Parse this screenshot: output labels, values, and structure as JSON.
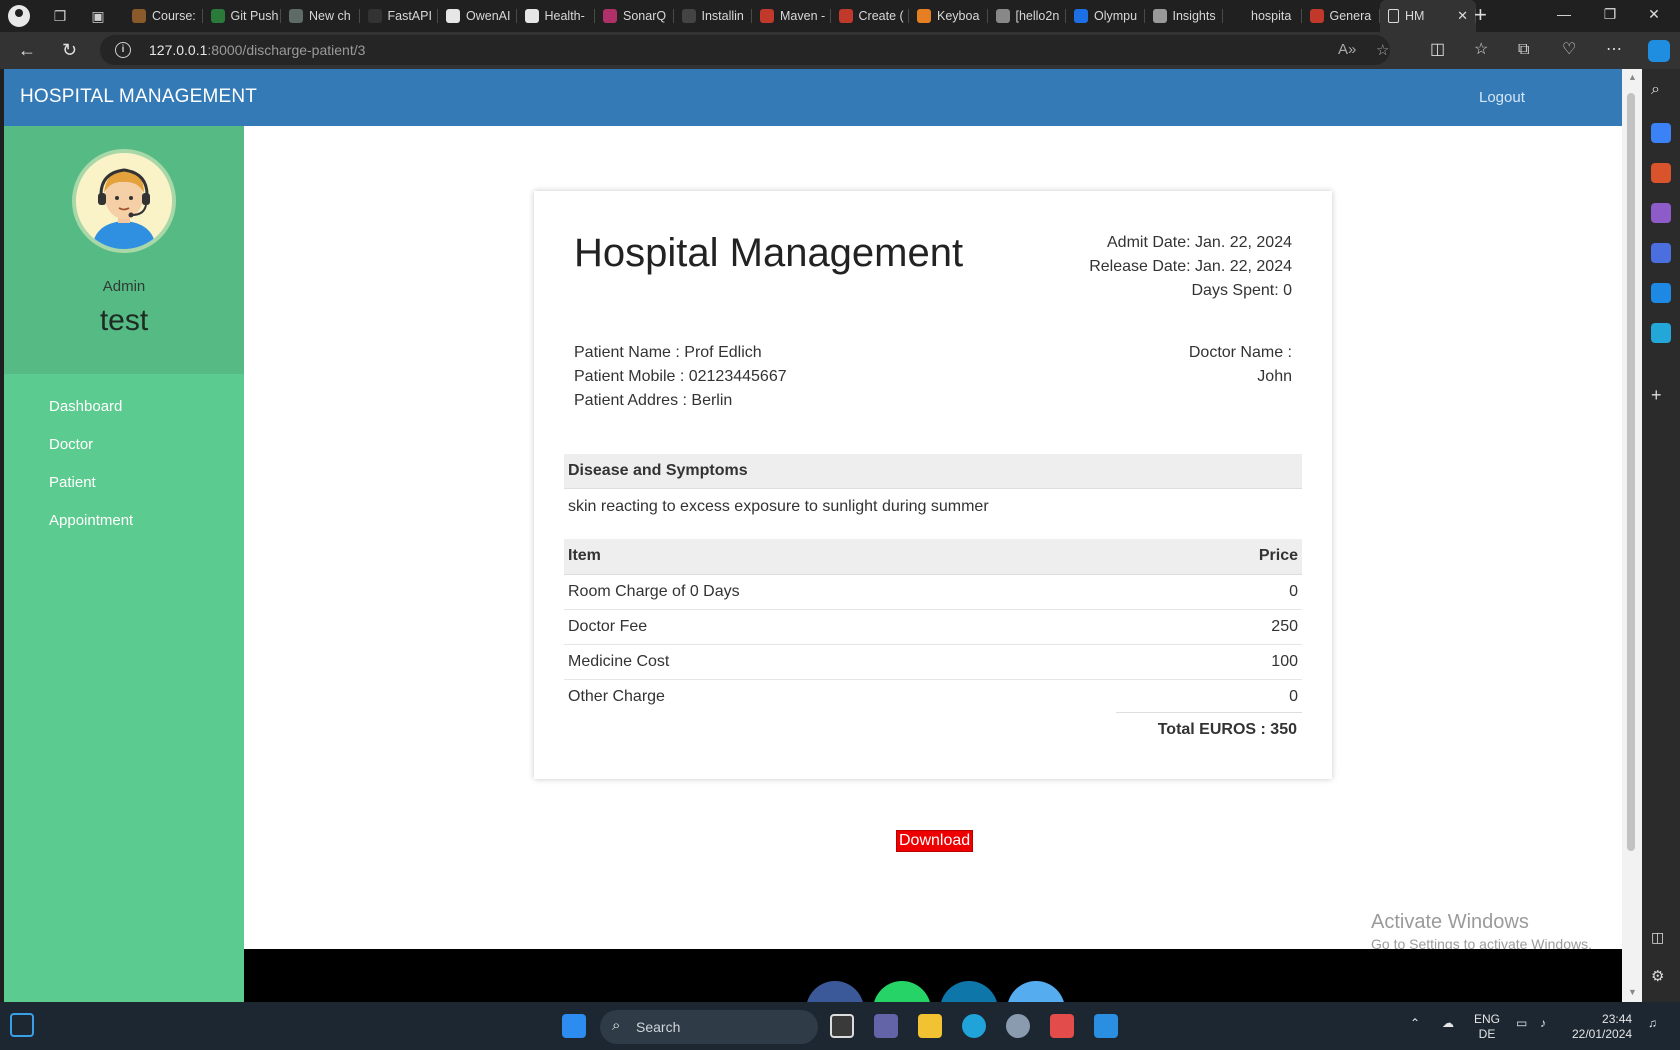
{
  "browser": {
    "tabs": [
      {
        "label": "Course:",
        "icon": "coursera-icon",
        "color": "#8a5a2b"
      },
      {
        "label": "Git Push",
        "icon": "w-icon",
        "color": "#2a7a3a"
      },
      {
        "label": "New ch",
        "icon": "chatgpt-icon",
        "color": "#5f6b66"
      },
      {
        "label": "FastAPI",
        "icon": "fastapi-icon",
        "color": "#333333"
      },
      {
        "label": "OwenAI",
        "icon": "github-icon",
        "color": "#e6e6e6"
      },
      {
        "label": "Health-",
        "icon": "github-icon",
        "color": "#e6e6e6"
      },
      {
        "label": "SonarQ",
        "icon": "sonarqube-icon",
        "color": "#b0306a"
      },
      {
        "label": "Installin",
        "icon": "docs-icon",
        "color": "#444444"
      },
      {
        "label": "Maven -",
        "icon": "maven-icon",
        "color": "#c0392b"
      },
      {
        "label": "Create (",
        "icon": "create-icon",
        "color": "#c0392b"
      },
      {
        "label": "Keyboa",
        "icon": "keyboard-icon",
        "color": "#e67e22"
      },
      {
        "label": "[hello2n",
        "icon": "gmail-icon",
        "color": "#888888"
      },
      {
        "label": "Olympu",
        "icon": "trello-icon",
        "color": "#1d6fe6"
      },
      {
        "label": "Insights",
        "icon": "insights-icon",
        "color": "#9a9a9a"
      },
      {
        "label": "hospita",
        "icon": "docs-icon",
        "color": "#202020"
      },
      {
        "label": "Genera",
        "icon": "generate-icon",
        "color": "#c0392b"
      }
    ],
    "active_tab": {
      "label": "HM",
      "icon": "page-icon"
    },
    "url_host": "127.0.0.1",
    "url_path": ":8000/discharge-patient/3"
  },
  "app": {
    "brand": "HOSPITAL MANAGEMENT",
    "logout": "Logout",
    "user": {
      "role": "Admin",
      "name": "test"
    },
    "menu": [
      "Dashboard",
      "Doctor",
      "Patient",
      "Appointment"
    ],
    "colors": {
      "navbar": "#337ab7",
      "sidebar": "#5ccb8f",
      "profile_box": "#55ba84",
      "download": "#ee0000"
    }
  },
  "bill": {
    "title": "Hospital Management",
    "admit_date": "Admit Date: Jan. 22, 2024",
    "release_date": "Release Date: Jan. 22, 2024",
    "days_spent": "Days Spent: 0",
    "patient_name": "Patient Name : Prof Edlich",
    "patient_mobile": "Patient Mobile : 02123445667",
    "patient_address": "Patient Addres : Berlin",
    "doctor_label": "Doctor Name :",
    "doctor_name": "John",
    "disease_heading": "Disease and Symptoms",
    "disease_text": "skin reacting to excess exposure to sunlight during summer",
    "item_header": "Item",
    "price_header": "Price",
    "items": [
      {
        "item": "Room Charge of 0 Days",
        "price": "0"
      },
      {
        "item": "Doctor Fee",
        "price": "250"
      },
      {
        "item": "Medicine Cost",
        "price": "100"
      },
      {
        "item": "Other Charge",
        "price": "0"
      }
    ],
    "total": "Total EUROS : 350"
  },
  "download_label": "Download",
  "watermark": {
    "title": "Activate Windows",
    "subtitle": "Go to Settings to activate Windows."
  },
  "taskbar": {
    "search_label": "Search",
    "lang": "ENG",
    "layout": "DE",
    "time": "23:44",
    "date": "22/01/2024"
  }
}
